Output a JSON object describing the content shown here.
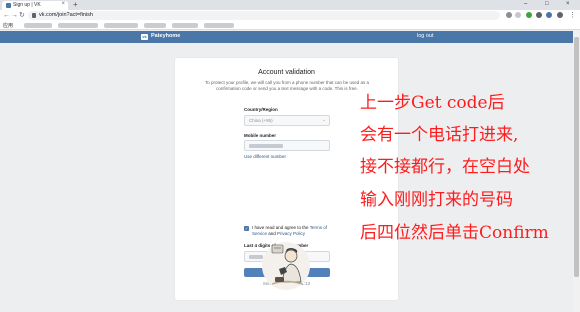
{
  "browser": {
    "tab_title": "Sign up | VK",
    "tab_close": "×",
    "new_tab": "+",
    "window_controls": [
      "–",
      "□",
      "×"
    ],
    "url": "vk.com/join?act=finish",
    "bookmarks_apps": "应用"
  },
  "vk_header": {
    "logo": "vk",
    "brand": "Pateyhome",
    "logout": "log out"
  },
  "card": {
    "title": "Account validation",
    "description": "To protect your profile, we will call you from a phone number that can be used as a confirmation code or send you a text message with a code. This is free.",
    "country_label": "Country/Region",
    "country_value": "China (+86)",
    "mobile_label": "Mobile number",
    "use_different": "Use different number",
    "agree_text_prefix": "I have read and agree to the ",
    "terms_link": "Terms of Service",
    "and": " and ",
    "privacy_link": "Privacy Policy",
    "last_digits_label": "Last 4 digits of phone number",
    "confirm_button": "Confirm",
    "resend": "Send SMS code in 1:13"
  },
  "annotation": {
    "lines": [
      "上一步Get code后",
      "会有一个电话打进来,",
      "接不接都行，在空白处",
      "输入刚刚打来的号码",
      "后四位然后单击Confirm"
    ],
    "color": "#ff1c1c"
  },
  "colors": {
    "vk_blue": "#4a76a8",
    "button_blue": "#5181b8",
    "page_bg": "#edeef0"
  }
}
